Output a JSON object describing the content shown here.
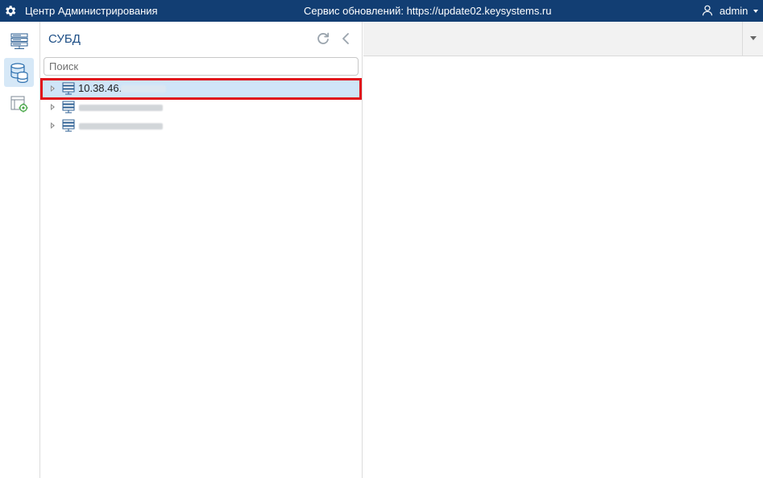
{
  "topbar": {
    "app_title": "Центр Администрирования",
    "service": "Сервис обновлений: https://update02.keysystems.ru",
    "user_name": "admin",
    "logo_icon": "gear-icon",
    "background": "#123e73"
  },
  "rail": {
    "items": [
      {
        "icon": "server-list-icon",
        "active": false
      },
      {
        "icon": "database-icon",
        "active": true
      },
      {
        "icon": "settings-window-icon",
        "active": false
      }
    ]
  },
  "panel": {
    "title": "СУБД",
    "search_placeholder": "Поиск",
    "tree": [
      {
        "label": "10.38.46.",
        "selected": true,
        "icon": "server-icon"
      },
      {
        "label": "",
        "selected": false,
        "icon": "server-icon"
      },
      {
        "label": "",
        "selected": false,
        "icon": "server-icon"
      }
    ]
  },
  "colors": {
    "accent": "#1e4f86",
    "selection": "#cfe5f8",
    "highlight_frame": "#e0141c"
  }
}
